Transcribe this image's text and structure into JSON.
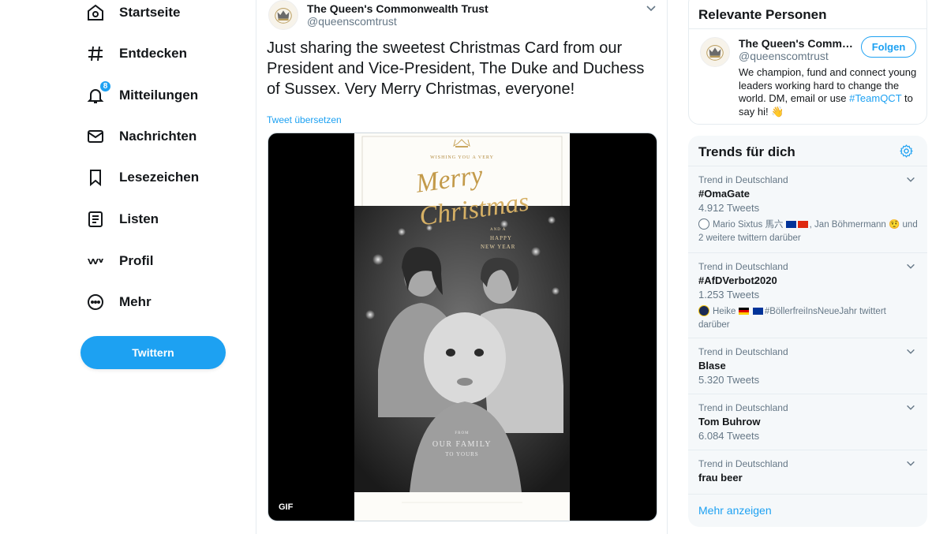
{
  "nav": {
    "items": [
      {
        "label": "Startseite",
        "icon": "home-icon"
      },
      {
        "label": "Entdecken",
        "icon": "hashtag-icon"
      },
      {
        "label": "Mitteilungen",
        "icon": "bell-icon",
        "badge": "8"
      },
      {
        "label": "Nachrichten",
        "icon": "mail-icon"
      },
      {
        "label": "Lesezeichen",
        "icon": "bookmark-icon"
      },
      {
        "label": "Listen",
        "icon": "list-icon"
      },
      {
        "label": "Profil",
        "icon": "profile-icon"
      },
      {
        "label": "Mehr",
        "icon": "more-icon"
      }
    ],
    "tweet_button": "Twittern"
  },
  "tweet": {
    "author_name": "The Queen's Commonwealth Trust",
    "author_handle": "@queenscomtrust",
    "text": "Just sharing the sweetest Christmas Card from our President and Vice-President, The Duke and Duchess of Sussex. Very Merry Christmas, everyone!",
    "translate": "Tweet übersetzen",
    "media_badge": "GIF",
    "card": {
      "wishing": "WISHING YOU A VERY",
      "merry": "Merry",
      "christmas": "Christmas",
      "and_a": "AND A",
      "happy": "HAPPY",
      "new_year": "NEW YEAR",
      "from": "FROM",
      "our_family": "OUR FAMILY",
      "to_yours": "TO YOURS"
    }
  },
  "related": {
    "title": "Relevante Personen",
    "name": "The Queen's Commonwealth Trust",
    "handle": "@queenscomtrust",
    "follow": "Folgen",
    "bio_text": "We champion, fund and connect young leaders working hard to change the world. DM, email or use",
    "bio_hashtag": "#TeamQCT",
    "bio_end": "to say hi! 👋"
  },
  "trends": {
    "title": "Trends für dich",
    "items": [
      {
        "context": "Trend in Deutschland",
        "name": "#OmaGate",
        "count": "4.912 Tweets",
        "meta_a": "Mario Sixtus 馬六",
        "meta_b": ", Jan Böhmermann 🤨 und 2 weitere twittern darüber"
      },
      {
        "context": "Trend in Deutschland",
        "name": "#AfDVerbot2020",
        "count": "1.253 Tweets",
        "meta_a": "Heike",
        "meta_b": "#BöllerfreiInsNeueJahr twittert darüber"
      },
      {
        "context": "Trend in Deutschland",
        "name": "Blase",
        "count": "5.320 Tweets"
      },
      {
        "context": "Trend in Deutschland",
        "name": "Tom Buhrow",
        "count": "6.084 Tweets"
      },
      {
        "context": "Trend in Deutschland",
        "name": "frau beer"
      }
    ],
    "show_more": "Mehr anzeigen"
  },
  "colors": {
    "accent": "#1da1f2",
    "secondary_text": "#657786",
    "border": "#e6ecf0",
    "panel_bg": "#f5f8fa"
  }
}
